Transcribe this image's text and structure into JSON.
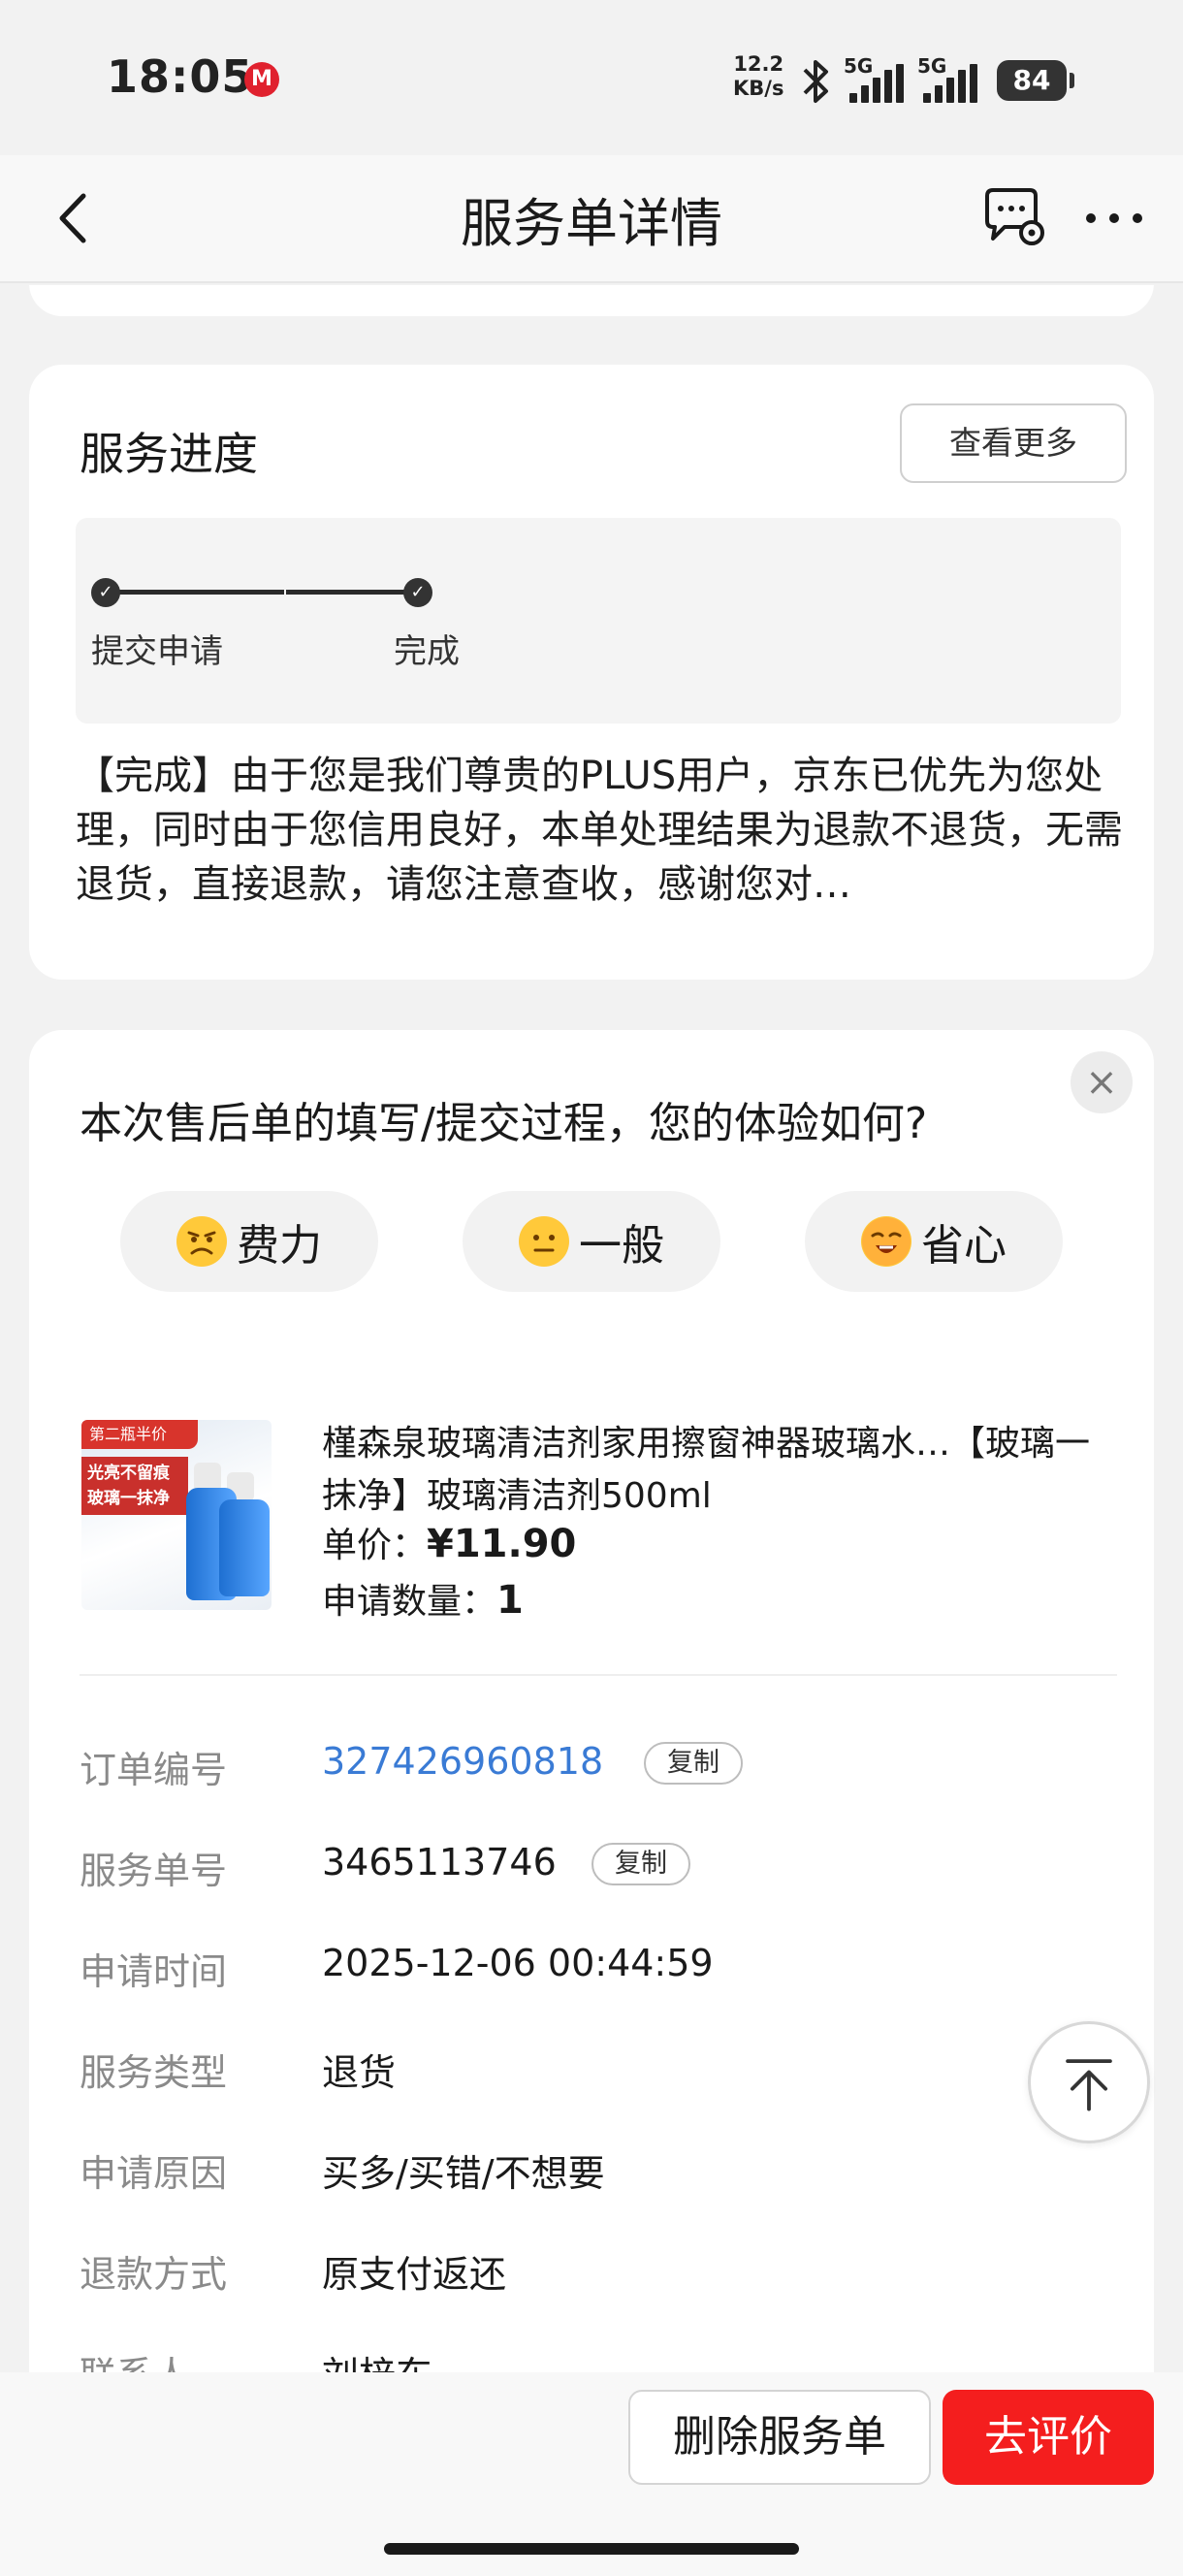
{
  "status_bar": {
    "time": "18:05",
    "carrier_icon": "M",
    "net_speed_value": "12.2",
    "net_speed_unit": "KB/s",
    "sim1_label": "5G",
    "sim2_label": "5G",
    "battery": "84"
  },
  "nav": {
    "title": "服务单详情"
  },
  "progress": {
    "title": "服务进度",
    "more_label": "查看更多",
    "steps": [
      {
        "label": "提交申请",
        "icon": "✓"
      },
      {
        "label": "完成",
        "icon": "✓"
      }
    ],
    "description": "【完成】由于您是我们尊贵的PLUS用户，京东已优先为您处理，同时由于您信用良好，本单处理结果为退款不退货，无需退货，直接退款，请您注意查收，感谢您对…"
  },
  "survey": {
    "question": "本次售后单的填写/提交过程，您的体验如何?",
    "close_icon": "×",
    "choices": [
      {
        "label": "费力",
        "icon": "frowning-face-icon"
      },
      {
        "label": "一般",
        "icon": "neutral-face-icon"
      },
      {
        "label": "省心",
        "icon": "relieved-face-icon"
      }
    ]
  },
  "product": {
    "image_badge": "第二瓶半价",
    "image_banner": "光亮不留痕 玻璃一抹净",
    "name": "槿森泉玻璃清洁剂家用擦窗神器玻璃水…【玻璃一抹净】玻璃清洁剂500ml",
    "price_label": "单价：",
    "price_value": "¥11.90",
    "qty_label": "申请数量：",
    "qty_value": "1"
  },
  "info": {
    "copy_label": "复制",
    "rows": [
      {
        "key": "订单编号",
        "value": "327426960818"
      },
      {
        "key": "服务单号",
        "value": "3465113746"
      },
      {
        "key": "申请时间",
        "value": "2025-12-06 00:44:59"
      },
      {
        "key": "服务类型",
        "value": "退货"
      },
      {
        "key": "申请原因",
        "value": "买多/买错/不想要"
      },
      {
        "key": "退款方式",
        "value": "原支付返还"
      },
      {
        "key": "联系人",
        "value": "刘梓东"
      }
    ]
  },
  "bottom": {
    "delete_label": "删除服务单",
    "review_label": "去评价"
  },
  "colors": {
    "accent_red": "#f41e1e",
    "link_blue": "#3a7bd5"
  }
}
